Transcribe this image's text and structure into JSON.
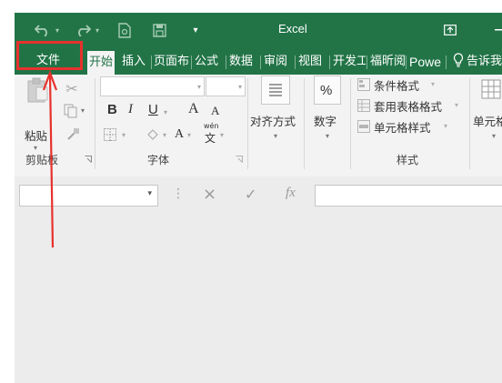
{
  "window": {
    "title": "Excel"
  },
  "tabs": {
    "file": "文件",
    "home": "开始",
    "insert": "插入",
    "page_layout": "页面布",
    "formulas": "公式",
    "data": "数据",
    "review": "审阅",
    "view": "视图",
    "developer": "开发工",
    "foxit": "福昕阅",
    "power": "Powe",
    "tell_me": "告诉我"
  },
  "ribbon": {
    "clipboard": {
      "paste": "粘贴",
      "group": "剪贴板"
    },
    "font": {
      "group": "字体",
      "bold": "B",
      "italic": "I",
      "underline": "U",
      "grow": "A",
      "shrink": "A",
      "font_color": "A",
      "phonetic": "文",
      "phonetic_top": "wén"
    },
    "alignment": {
      "label": "对齐方式"
    },
    "number": {
      "label": "数字",
      "percent": "%"
    },
    "styles": {
      "conditional": "条件格式",
      "table": "套用表格格式",
      "cell": "单元格样式",
      "group": "样式"
    },
    "cells": {
      "label": "单元格"
    }
  },
  "formula_bar": {
    "cancel": "×",
    "enter": "✓",
    "fx": "fx",
    "colon": "⋮"
  },
  "colors": {
    "excel_green": "#217346",
    "annotation_red": "#e8312d"
  }
}
